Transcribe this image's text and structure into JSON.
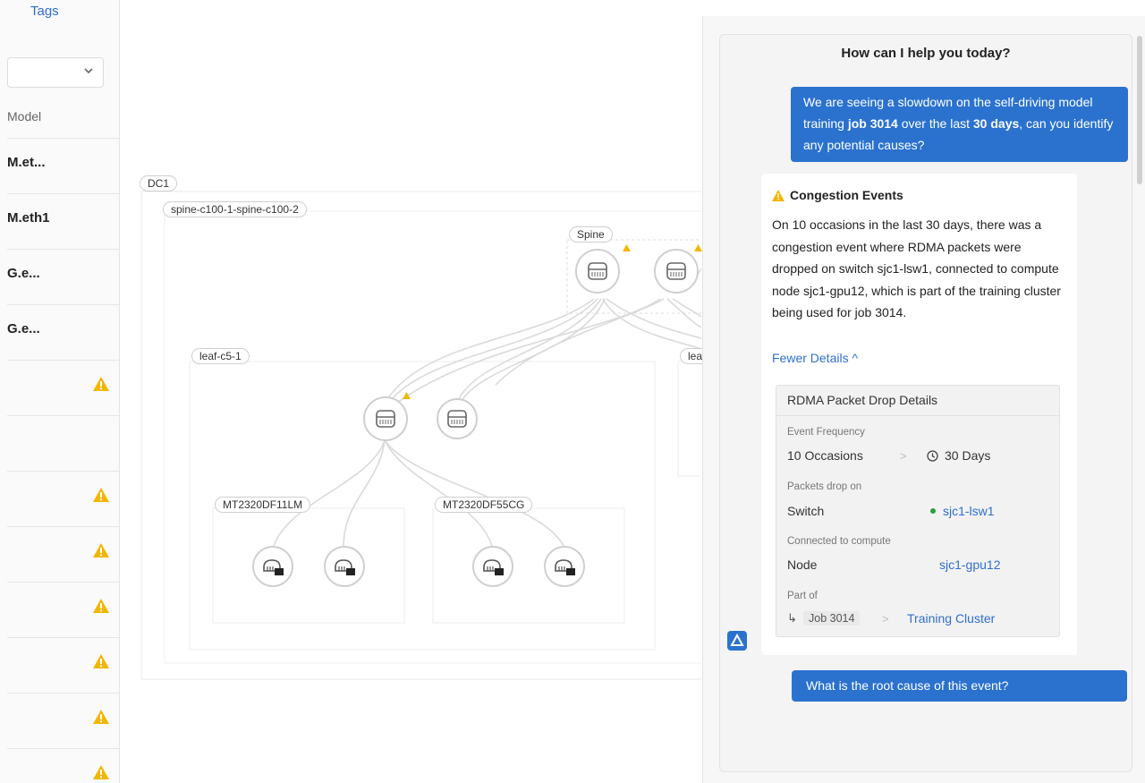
{
  "left_panel": {
    "tags_link": "Tags",
    "filter_select": {
      "value": ""
    },
    "column_header": "Model",
    "rows": [
      {
        "text": "M.et...",
        "warning": false
      },
      {
        "text": "M.eth1",
        "warning": false
      },
      {
        "text": "G.e...",
        "warning": false
      },
      {
        "text": "G.e...",
        "warning": false
      },
      {
        "text": "",
        "warning": true
      },
      {
        "text": "",
        "warning": false
      },
      {
        "text": "",
        "warning": true
      },
      {
        "text": "",
        "warning": true
      },
      {
        "text": "",
        "warning": true
      },
      {
        "text": "",
        "warning": true
      },
      {
        "text": "",
        "warning": true
      },
      {
        "text": "",
        "warning": true
      }
    ]
  },
  "topology": {
    "dc_label": "DC1",
    "spine_group_label": "spine-c100-1-spine-c100-2",
    "spine_label": "Spine",
    "leaf_group_label": "leaf-c5-1",
    "leaf_group_label_2": "lea",
    "host_group_1": "MT2320DF11LM",
    "host_group_2": "MT2320DF55CG",
    "colors": {
      "link": "#d7d7d7",
      "node_border": "#cfcfcf",
      "warning": "#f2b600"
    }
  },
  "assistant": {
    "title": "How can I help you today?",
    "user_message_1": {
      "t1": "We are seeing a slowdown on the self-driving model training ",
      "b1": "job 3014",
      "t2": " over the last ",
      "b2": "30 days",
      "t3": ", can you identify any potential causes?"
    },
    "response": {
      "title": "Congestion Events",
      "body": "On 10 occasions in the last 30 days, there was a congestion event where RDMA packets were dropped on switch sjc1-lsw1, connected to compute node sjc1-gpu12, which is part of the training cluster being used for job 3014.",
      "fewer_details": "Fewer Details ^",
      "details": {
        "title": "RDMA Packet Drop Details",
        "event_frequency_label": "Event Frequency",
        "event_frequency_value": "10 Occasions",
        "event_frequency_sep": ">",
        "event_frequency_days": "30 Days",
        "packets_drop_label": "Packets drop on",
        "packets_drop_value": "Switch",
        "packets_drop_link": "sjc1-lsw1",
        "connected_label": "Connected to compute",
        "connected_value": "Node",
        "connected_link": "sjc1-gpu12",
        "part_of_label": "Part of",
        "part_of_arrow": "↳",
        "part_of_job": "Job 3014",
        "part_of_sep": ">",
        "part_of_link": "Training Cluster"
      }
    },
    "user_message_2": "What is the root cause of this event?",
    "colors": {
      "accent": "#2b72cf",
      "link": "#2f6fcf",
      "status_green": "#27a043"
    }
  }
}
